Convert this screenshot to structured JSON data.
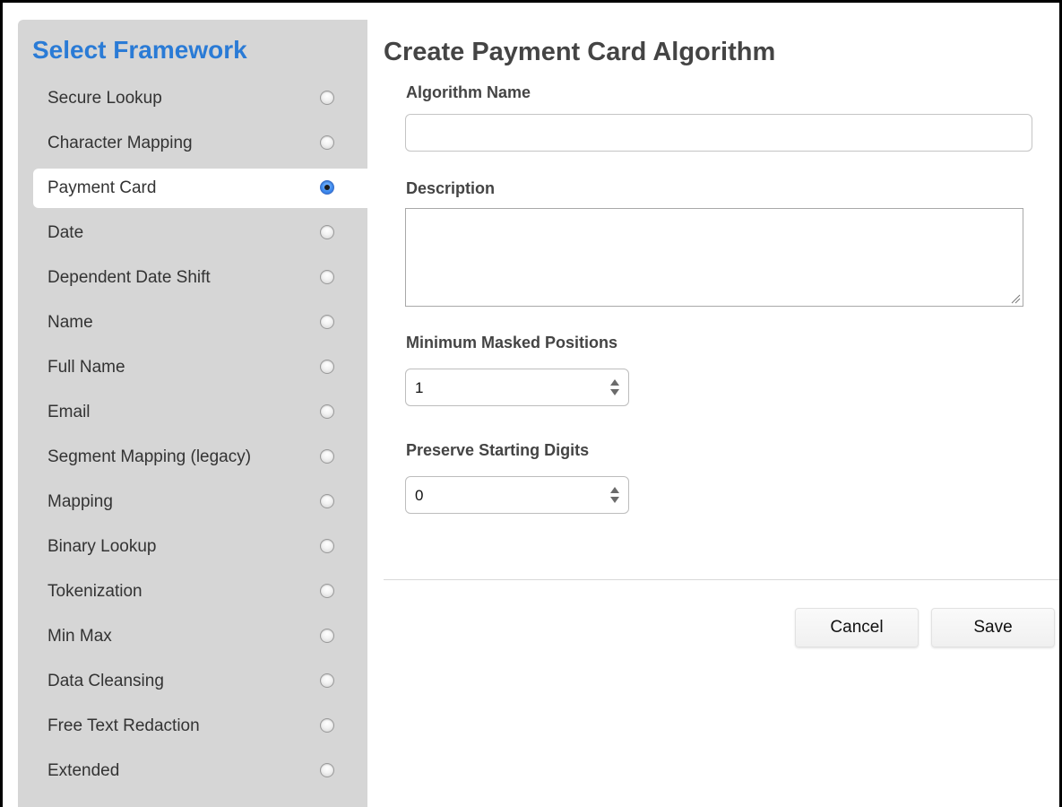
{
  "sidebar": {
    "title": "Select Framework",
    "items": [
      {
        "label": "Secure Lookup",
        "selected": false
      },
      {
        "label": "Character Mapping",
        "selected": false
      },
      {
        "label": "Payment Card",
        "selected": true
      },
      {
        "label": "Date",
        "selected": false
      },
      {
        "label": "Dependent Date Shift",
        "selected": false
      },
      {
        "label": "Name",
        "selected": false
      },
      {
        "label": "Full Name",
        "selected": false
      },
      {
        "label": "Email",
        "selected": false
      },
      {
        "label": "Segment Mapping (legacy)",
        "selected": false
      },
      {
        "label": "Mapping",
        "selected": false
      },
      {
        "label": "Binary Lookup",
        "selected": false
      },
      {
        "label": "Tokenization",
        "selected": false
      },
      {
        "label": "Min Max",
        "selected": false
      },
      {
        "label": "Data Cleansing",
        "selected": false
      },
      {
        "label": "Free Text Redaction",
        "selected": false
      },
      {
        "label": "Extended",
        "selected": false
      }
    ]
  },
  "form": {
    "title": "Create Payment Card Algorithm",
    "algorithm_name": {
      "label": "Algorithm Name",
      "value": "",
      "placeholder": ""
    },
    "description": {
      "label": "Description",
      "value": "",
      "placeholder": ""
    },
    "min_masked_positions": {
      "label": "Minimum Masked Positions",
      "value": "1"
    },
    "preserve_starting_digits": {
      "label": "Preserve Starting Digits",
      "value": "0"
    }
  },
  "actions": {
    "cancel_label": "Cancel",
    "save_label": "Save"
  },
  "colors": {
    "accent": "#2a7bd6",
    "sidebar_bg": "#d6d6d6"
  }
}
